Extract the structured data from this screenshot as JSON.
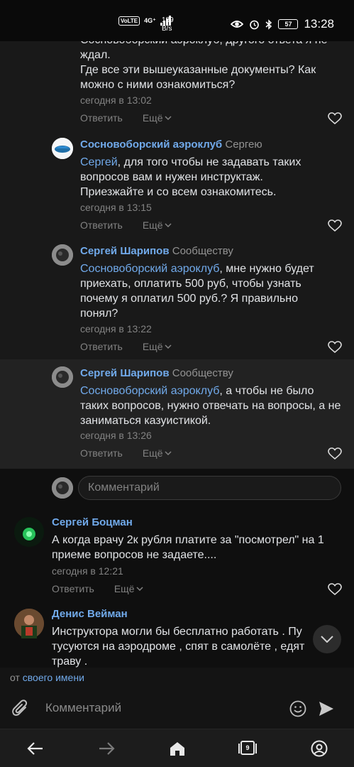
{
  "status_bar": {
    "volte": "VoLTE",
    "network": "4G⁺",
    "speed_value": "189",
    "speed_unit": "B/s",
    "battery": "57",
    "time": "13:28"
  },
  "comments": [
    {
      "text_tail_1": "ждал.",
      "text_tail_0": "Сосновоборский аэроклуб, другого ответа я не",
      "text_rest": "Где все эти вышеуказанные документы? Как можно с ними ознакомиться?",
      "time": "сегодня в 13:02",
      "reply_label": "Ответить",
      "more_label": "Ещё"
    },
    {
      "author": "Сосновоборский аэроклуб",
      "reply_to": "Сергею",
      "mention": "Сергей",
      "text": ", для того чтобы не задавать таких вопросов вам и нужен инструктаж. Приезжайте и со всем ознакомитесь.",
      "time": "сегодня в 13:15",
      "reply_label": "Ответить",
      "more_label": "Ещё"
    },
    {
      "author": "Сергей Шарипов",
      "reply_to": "Сообществу",
      "mention": "Сосновоборский аэроклуб",
      "text": ", мне нужно будет приехать, оплатить 500 руб, чтобы узнать почему я оплатил 500 руб.? Я правильно понял?",
      "time": "сегодня в 13:22",
      "reply_label": "Ответить",
      "more_label": "Ещё"
    },
    {
      "author": "Сергей Шарипов",
      "reply_to": "Сообществу",
      "mention": "Сосновоборский аэроклуб",
      "text": ", а чтобы не было таких вопросов, нужно отвечать на вопросы, а не заниматься казуистикой.",
      "time": "сегодня в 13:26",
      "reply_label": "Ответить",
      "more_label": "Ещё"
    },
    {
      "author": "Сергей Боцман",
      "text": "А когда врачу 2к рубля платите за \"посмотрел\" на 1 приеме вопросов не задаете....",
      "time": "сегодня в 12:21",
      "reply_label": "Ответить",
      "more_label": "Ещё"
    },
    {
      "author": "Денис Вейман",
      "text": "Инструктора могли бы бесплатно работать . Пу тусуются на аэродроме , спят в самолёте , едят траву ."
    }
  ],
  "thread_input": {
    "placeholder": "Комментарий"
  },
  "from_row": {
    "prefix": "от",
    "link": "своего имени"
  },
  "composer": {
    "placeholder": "Комментарий"
  },
  "navbar": {
    "tab_count": "9"
  }
}
